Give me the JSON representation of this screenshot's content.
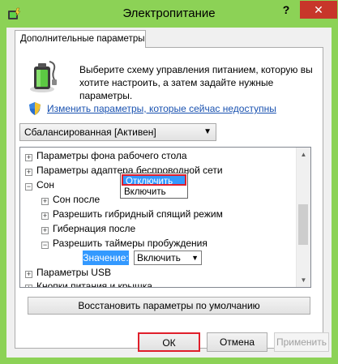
{
  "window": {
    "title": "Электропитание",
    "help_glyph": "?",
    "close_glyph": "✕"
  },
  "tab": {
    "label": "Дополнительные параметры"
  },
  "intro": {
    "description": "Выберите схему управления питанием, которую вы хотите настроить, а затем задайте нужные параметры.",
    "change_link": "Изменить параметры, которые сейчас недоступны"
  },
  "scheme": {
    "selected": "Сбалансированная [Активен]"
  },
  "tree": {
    "rows": [
      {
        "label": "Параметры фона рабочего стола",
        "expander": "+"
      },
      {
        "label": "Параметры адаптера беспроводной сети",
        "expander": "+"
      },
      {
        "label": "Сон",
        "expander": "−"
      },
      {
        "label": "Сон после",
        "expander": "+"
      },
      {
        "label": "Разрешить гибридный спящий режим",
        "expander": "+"
      },
      {
        "label": "Гибернация после",
        "expander": "+"
      },
      {
        "label": "Разрешить таймеры пробуждения",
        "expander": "−"
      },
      {
        "label": "Параметры USB",
        "expander": "+"
      },
      {
        "label": "Кнопки питания и крышка",
        "expander": "+"
      }
    ],
    "value_label": "Значение:",
    "value_selected": "Включить",
    "options": [
      "Отключить",
      "Включить"
    ]
  },
  "buttons": {
    "restore": "Восстановить параметры по умолчанию",
    "ok": "ОК",
    "cancel": "Отмена",
    "apply": "Применить"
  },
  "colors": {
    "title_bar": "#8cd256",
    "close": "#c7362a",
    "highlight": "#3399ff",
    "callout": "#e01f2b",
    "link": "#1a52b0"
  }
}
